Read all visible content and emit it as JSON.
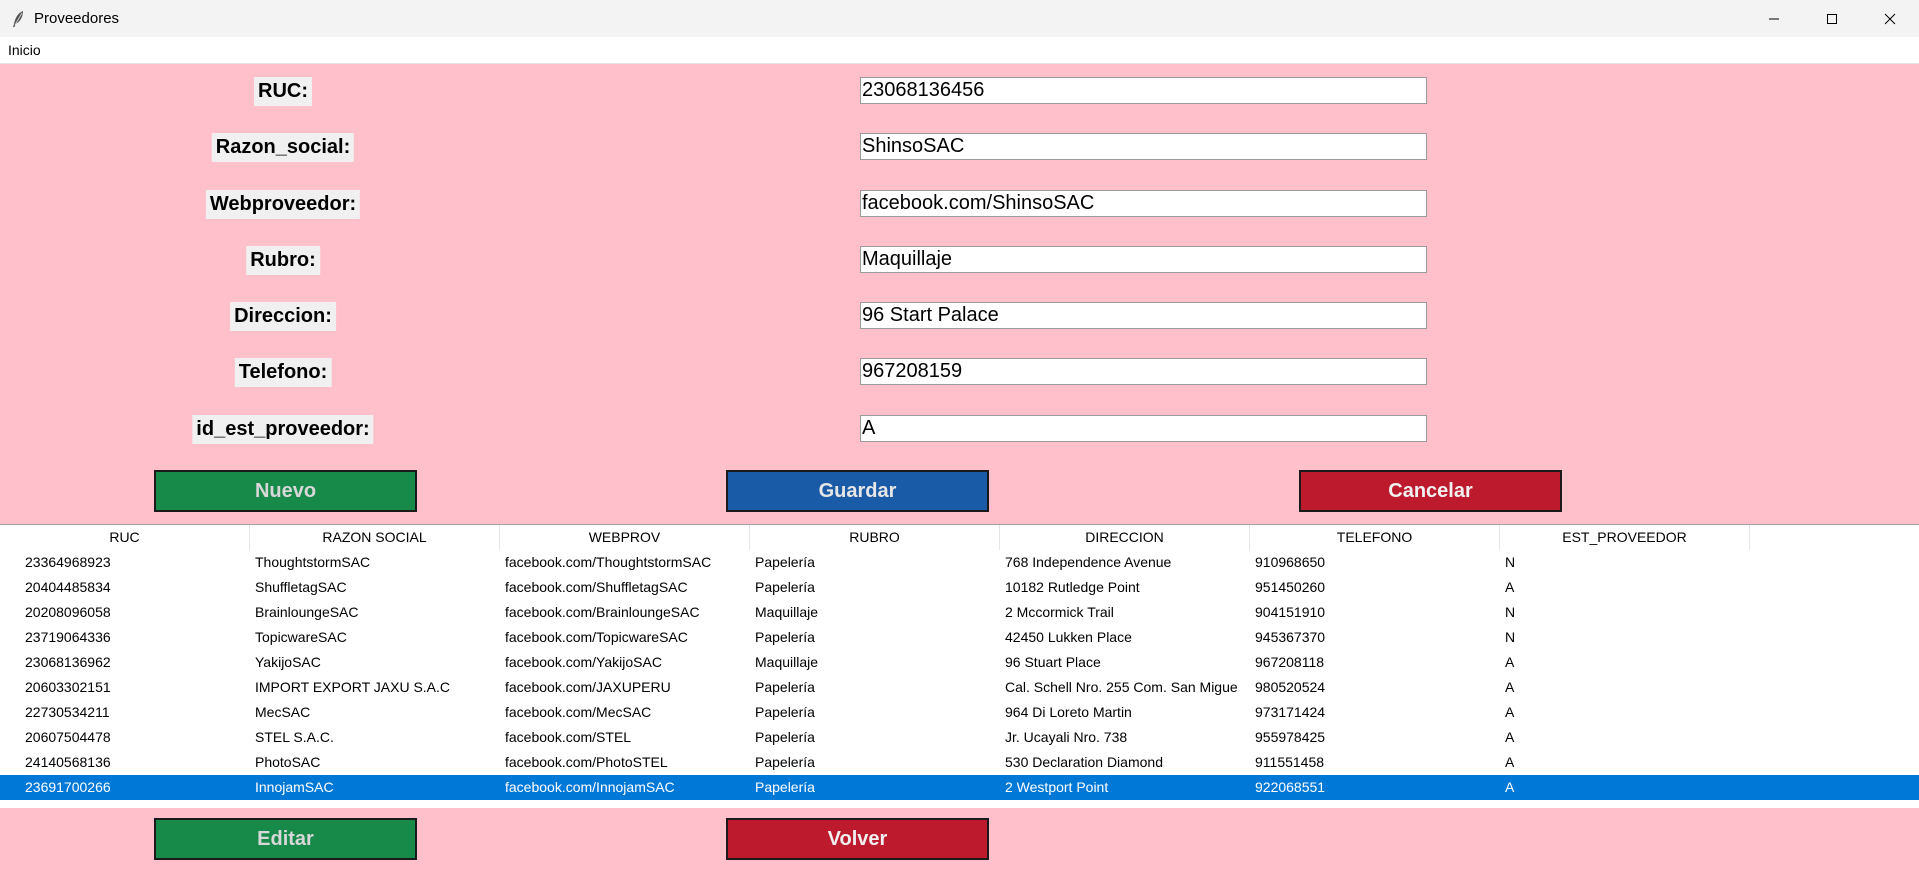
{
  "window": {
    "title": "Proveedores"
  },
  "menu": {
    "items": [
      "Inicio"
    ]
  },
  "form": {
    "fields": [
      {
        "label": "RUC:",
        "value": "23068136456"
      },
      {
        "label": "Razon_social:",
        "value": "ShinsoSAC"
      },
      {
        "label": "Webproveedor:",
        "value": "facebook.com/ShinsoSAC"
      },
      {
        "label": "Rubro:",
        "value": "Maquillaje"
      },
      {
        "label": "Direccion:",
        "value": "96 Start Palace"
      },
      {
        "label": "Telefono:",
        "value": "967208159"
      },
      {
        "label": "id_est_proveedor:",
        "value": "A"
      }
    ]
  },
  "buttons": {
    "nuevo": "Nuevo",
    "guardar": "Guardar",
    "cancelar": "Cancelar",
    "editar": "Editar",
    "volver": "Volver"
  },
  "table": {
    "columns": [
      "RUC",
      "RAZON SOCIAL",
      "WEBPROV",
      "RUBRO",
      "DIRECCION",
      "TELEFONO",
      "EST_PROVEEDOR"
    ],
    "rows": [
      [
        "23364968923",
        "ThoughtstormSAC",
        "facebook.com/ThoughtstormSAC",
        "Papelería",
        "768 Independence Avenue",
        "910968650",
        "N"
      ],
      [
        "20404485834",
        "ShuffletagSAC",
        "facebook.com/ShuffletagSAC",
        "Papelería",
        "10182 Rutledge Point",
        "951450260",
        "A"
      ],
      [
        "20208096058",
        "BrainloungeSAC",
        "facebook.com/BrainloungeSAC",
        "Maquillaje",
        "2 Mccormick Trail",
        "904151910",
        "N"
      ],
      [
        "23719064336",
        "TopicwareSAC",
        "facebook.com/TopicwareSAC",
        "Papelería",
        "42450 Lukken Place",
        "945367370",
        "N"
      ],
      [
        "23068136962",
        "YakijoSAC",
        "facebook.com/YakijoSAC",
        "Maquillaje",
        "96 Stuart Place",
        "967208118",
        "A"
      ],
      [
        "20603302151",
        "IMPORT EXPORT JAXU S.A.C",
        "facebook.com/JAXUPERU",
        "Papelería",
        "Cal. Schell Nro. 255 Com. San Migue",
        "980520524",
        "A"
      ],
      [
        "22730534211",
        "MecSAC",
        "facebook.com/MecSAC",
        "Papelería",
        "964 Di Loreto Martin",
        "973171424",
        "A"
      ],
      [
        "20607504478",
        "STEL S.A.C.",
        "facebook.com/STEL",
        "Papelería",
        "Jr. Ucayali Nro. 738",
        "955978425",
        "A"
      ],
      [
        "24140568136",
        "PhotoSAC",
        "facebook.com/PhotoSTEL",
        "Papelería",
        "530 Declaration Diamond",
        "911551458",
        "A"
      ],
      [
        "23691700266",
        "InnojamSAC",
        "facebook.com/InnojamSAC",
        "Papelería",
        "2 Westport Point",
        "922068551",
        "A"
      ]
    ],
    "selected_row": 9
  },
  "colors": {
    "background": "#ffbfcb",
    "green_button": "#178a4a",
    "blue_button": "#1a5ba8",
    "red_button": "#bd1a2e",
    "selection": "#0078d7"
  }
}
